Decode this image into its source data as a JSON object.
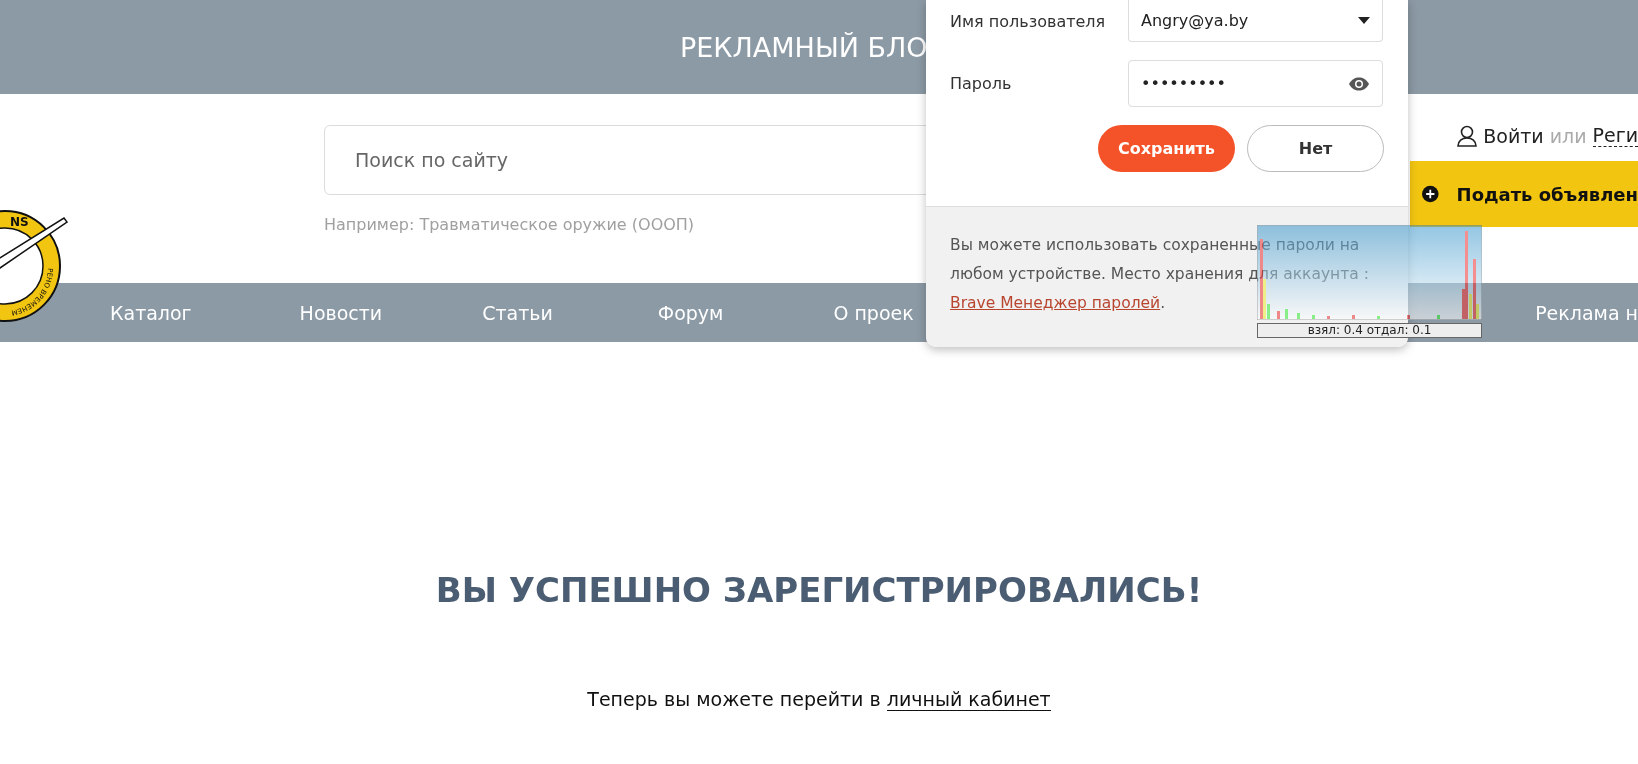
{
  "banner": {
    "text": "РЕКЛАМНЫЙ БЛО"
  },
  "logo": {
    "texts": [
      "NS",
      "РЕНО ВРЕМЕНЕМ"
    ]
  },
  "search": {
    "placeholder": "Поиск по сайту",
    "hint": "Например: Травматическое оружие (ОООП)"
  },
  "account": {
    "login": "Войти",
    "separator": "или",
    "register": "Реги"
  },
  "post_ad_button": {
    "label": "Подать объявлен"
  },
  "nav": [
    {
      "label": "Каталог"
    },
    {
      "label": "Новости"
    },
    {
      "label": "Статьи"
    },
    {
      "label": "Форум"
    },
    {
      "label": "О проек"
    },
    {
      "label": "Реклама н"
    }
  ],
  "main": {
    "heading": "ВЫ УСПЕШНО ЗАРЕГИСТРИРОВАЛИСЬ!",
    "text": "Теперь вы можете перейти в ",
    "link": "личный кабинет"
  },
  "password_popup": {
    "username_label": "Имя пользователя",
    "username": "Angry@ya.by",
    "password_label": "Пароль",
    "password": "•••••••••",
    "buttons": [
      {
        "label": "Сохранить",
        "kind": "primary"
      },
      {
        "label": "Нет",
        "kind": "secondary"
      }
    ],
    "note": "Вы можете использовать сохраненные пароли на любом устройстве. Место хранения для аккаунта :",
    "note_link": "Brave Менеджер паролей",
    "note_end": "."
  },
  "traffic_widget": {
    "caption": "взял: 0.4 отдал: 0.1"
  }
}
